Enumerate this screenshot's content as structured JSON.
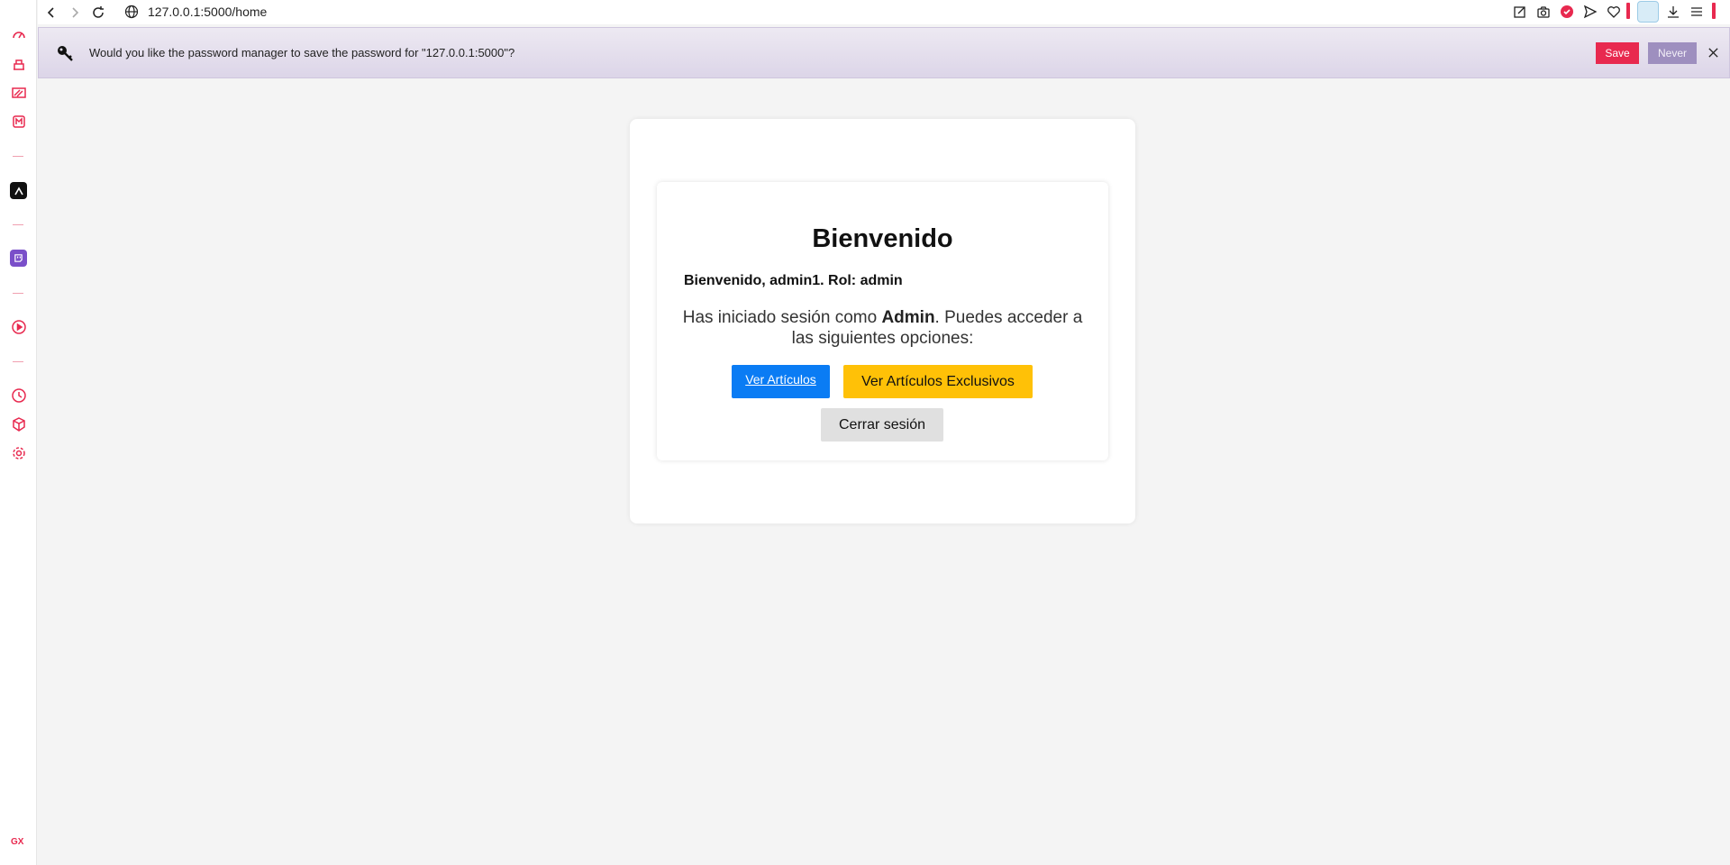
{
  "browser": {
    "url": "127.0.0.1:5000/home",
    "sidebar_brand": "GX",
    "accent_color": "#e8294f"
  },
  "password_bar": {
    "message": "Would you like the password manager to save the password for \"127.0.0.1:5000\"?",
    "save_label": "Save",
    "never_label": "Never"
  },
  "page": {
    "title": "Bienvenido",
    "welcome_line": "Bienvenido, admin1. Rol: admin",
    "desc_prefix": "Has iniciado sesión como ",
    "desc_role": "Admin",
    "desc_suffix": ". Puedes acceder a las siguientes opciones:",
    "btn_articulos": "Ver Artículos",
    "btn_exclusivos": "Ver Artículos Exclusivos",
    "btn_logout": "Cerrar sesión",
    "colors": {
      "articulos": "#0a7cf4",
      "exclusivos": "#ffc107",
      "logout": "#e0e0e0"
    }
  }
}
